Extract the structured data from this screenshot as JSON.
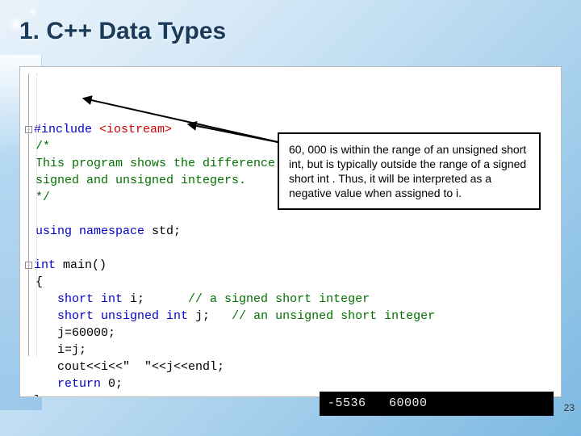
{
  "title": "1. C++ Data Types",
  "page_number": "23",
  "annotation_text": "60, 000 is within the range of an unsigned short int, but is typically outside the range of a signed short int . Thus, it will be interpreted as a negative value when assigned to i.",
  "console_output": "-5536   60000",
  "code": {
    "include_directive": "#include",
    "include_lib": "<iostream>",
    "comment_line1": "/*",
    "comment_line2": "This program shows the difference between",
    "comment_line3": "signed and unsigned integers.",
    "comment_line4": "*/",
    "using_kw": "using namespace",
    "using_rest": " std;",
    "int_kw": "int",
    "main_rest": " main()",
    "brace_open": "{",
    "decl1_kw": "short int",
    "decl1_rest": " i;      ",
    "decl1_cmt": "// a signed short integer",
    "decl2_kw": "short unsigned int",
    "decl2_rest": " j;   ",
    "decl2_cmt": "// an unsigned short integer",
    "stmt1": "j=60000;",
    "stmt2": "i=j;",
    "stmt3": "cout<<i<<\"  \"<<j<<endl;",
    "ret_kw": "return",
    "ret_rest": " 0;",
    "brace_close": "}"
  }
}
